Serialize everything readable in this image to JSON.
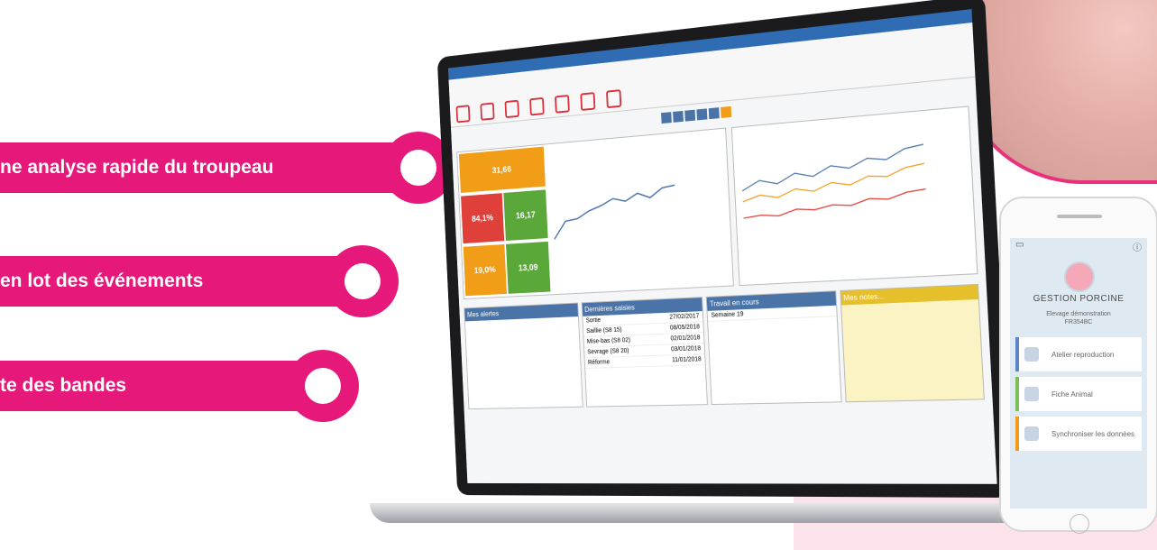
{
  "banners": [
    {
      "text": "ne analyse rapide du troupeau"
    },
    {
      "text": "en lot des événements"
    },
    {
      "text": "te des bandes"
    }
  ],
  "colors": {
    "accent": "#e6197a",
    "app_blue": "#2f6cb3",
    "orange_tile": "#f29d18",
    "green_tile": "#5aa83a",
    "red_tile": "#e0403a"
  },
  "app": {
    "tiles": [
      {
        "value": "31,66"
      },
      {
        "value": "84,1%"
      },
      {
        "value": "16,17"
      },
      {
        "value": "19,0%"
      },
      {
        "value": "13,09"
      }
    ],
    "panels": {
      "alerts_title": "Mes alertes",
      "entries_title": "Dernières saisies",
      "work_title": "Travail en cours",
      "notes_title": "Mes notes..."
    },
    "entries": [
      {
        "label": "Sortie",
        "date": "27/02/2017"
      },
      {
        "label": "Saillie (S8 15)",
        "date": "08/05/2018"
      },
      {
        "label": "Mise-bas (S8 02)",
        "date": "02/01/2018"
      },
      {
        "label": "Sevrage (S8 20)",
        "date": "03/01/2018"
      },
      {
        "label": "Réforme",
        "date": "11/01/2018"
      }
    ],
    "work": [
      {
        "label": "Semaine 19"
      }
    ]
  },
  "phone": {
    "title": "GESTION PORCINE",
    "subtitle_line1": "Elevage démonstration",
    "subtitle_line2": "FR354BC",
    "buttons": [
      {
        "label": "Atelier reproduction",
        "icon": "chart-icon"
      },
      {
        "label": "Fiche Animal",
        "icon": "pig-icon"
      },
      {
        "label": "Synchroniser les données",
        "icon": "sync-icon"
      }
    ]
  }
}
